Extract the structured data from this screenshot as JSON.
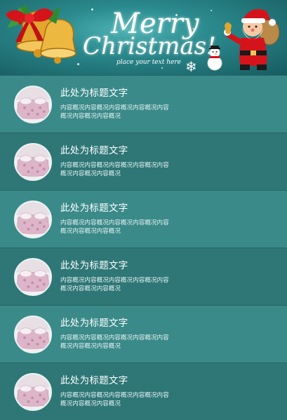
{
  "banner": {
    "line1": "Merry",
    "line2": "Christmas!",
    "subtitle": "place your text here"
  },
  "list": {
    "items": [
      {
        "title": "此处为标题文字",
        "description": "内容概况内容概况内容概况内容概况内容概况内容概况内容概况"
      },
      {
        "title": "此处为标题文字",
        "description": "内容概况内容概况内容概况内容概况内容概况内容概况内容概况"
      },
      {
        "title": "此处为标题文字",
        "description": "内容概况内容概况内容概况内容概况内容概况内容概况内容概况"
      },
      {
        "title": "此处为标题文字",
        "description": "内容概况内容概况内容概况内容概况内容概况内容概况内容概况"
      },
      {
        "title": "此处为标题文字",
        "description": "内容概况内容概况内容概况内容概况内容概况内容概况内容概况"
      },
      {
        "title": "此处为标题文字",
        "description": "内容概况内容概况内容概况内容概况内容概况内容概况内容概况"
      }
    ]
  }
}
